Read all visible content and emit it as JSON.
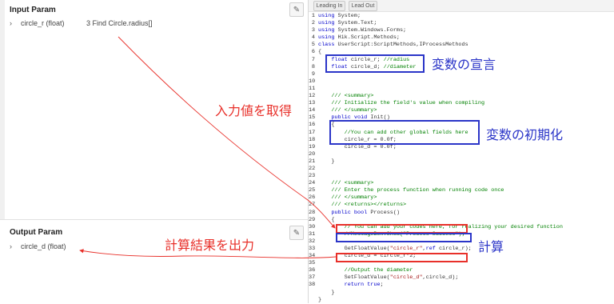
{
  "left": {
    "input_title": "Input Param",
    "input_params": [
      {
        "name": "circle_r (float)",
        "value": "3 Find Circle.radius[]"
      }
    ],
    "output_title": "Output Param",
    "output_params": [
      {
        "name": "circle_d (float)",
        "value": ""
      }
    ],
    "edit_icon": "pencil-icon"
  },
  "tabs": [
    "Leading In",
    "Lead Out"
  ],
  "code_lines": [
    "using System;",
    "using System.Text;",
    "using System.Windows.Forms;",
    "using Hik.Script.Methods;",
    "class UserScript:ScriptMethods,IProcessMethods",
    "{",
    "    float circle_r; //radius",
    "    float circle_d; //diameter",
    "",
    "",
    "",
    "    /// <summary>",
    "    /// Initialize the field's value when compiling",
    "    /// </summary>",
    "    public void Init()",
    "    {",
    "        //You can add other global fields here",
    "        circle_r = 0.0f;",
    "        circle_d = 0.0f;",
    "",
    "    }",
    "",
    "",
    "    /// <summary>",
    "    /// Enter the process function when running code once",
    "    /// </summary>",
    "    /// <returns></returns>",
    "    public bool Process()",
    "    {",
    "        // You can add your codes here, for realizing your desired function",
    "        //MessageBox.Show(\"Process Success\");",
    "",
    "        GetFloatValue(\"circle_r\",ref circle_r);",
    "        circle_d = circle_r*2;",
    "",
    "        //Output the diameter",
    "        SetFloatValue(\"circle_d\",circle_d);",
    "        return true;",
    "    }",
    "}"
  ],
  "line_numbers": [
    "1",
    "2",
    "3",
    "4",
    "5",
    "6",
    "7",
    "8",
    "9",
    "10",
    "11",
    "12",
    "13",
    "14",
    "15",
    "16",
    "17",
    "18",
    "19",
    "20",
    "21",
    "22",
    "23",
    "24",
    "25",
    "26",
    "27",
    "28",
    "29",
    "30",
    "31",
    "32",
    "33",
    "34",
    "35",
    "36",
    "37",
    "38"
  ],
  "annotations": {
    "declare": "変数の宣言",
    "init": "変数の初期化",
    "get_input": "入力値を取得",
    "calc": "計算",
    "output": "計算結果を出力"
  },
  "colors": {
    "red": "#e8302a",
    "blue": "#2b35c8",
    "keyword": "#0000cc",
    "comment": "#008000",
    "string": "#a31515"
  }
}
